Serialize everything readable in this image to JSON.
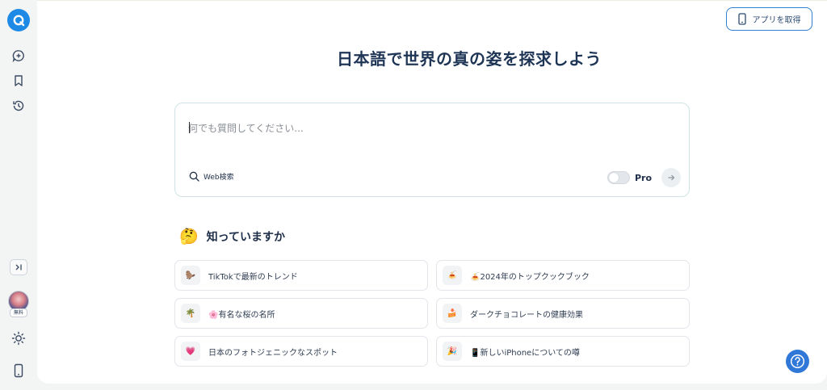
{
  "header": {
    "get_app_label": "アプリを取得"
  },
  "main": {
    "headline": "日本語で世界の真の姿を探求しよう"
  },
  "search": {
    "placeholder": "何でも質問してください...",
    "web_search_label": "Web検索",
    "pro_label": "Pro"
  },
  "did_you_know": {
    "emoji": "🤔",
    "title": "知っていますか",
    "items": [
      {
        "icon": "🦫",
        "label": "TikTokで最新のトレンド"
      },
      {
        "icon": "🍝",
        "label": "🍝2024年のトップクックブック"
      },
      {
        "icon": "🌴",
        "label": "🌸有名な桜の名所"
      },
      {
        "icon": "🍰",
        "label": "ダークチョコレートの健康効果"
      },
      {
        "icon": "💗",
        "label": "日本のフォトジェニックなスポット"
      },
      {
        "icon": "🎉",
        "label": "📱新しいiPhoneについての噂"
      }
    ]
  },
  "sidebar": {
    "free_badge": "無料",
    "icons": [
      "new-chat-icon",
      "bookmark-icon",
      "history-icon",
      "expand-sidebar-icon",
      "theme-toggle-icon",
      "mobile-app-icon"
    ]
  },
  "colors": {
    "accent": "#1f8ae6",
    "headline": "#1f3556",
    "help_button": "#2f78d8"
  }
}
